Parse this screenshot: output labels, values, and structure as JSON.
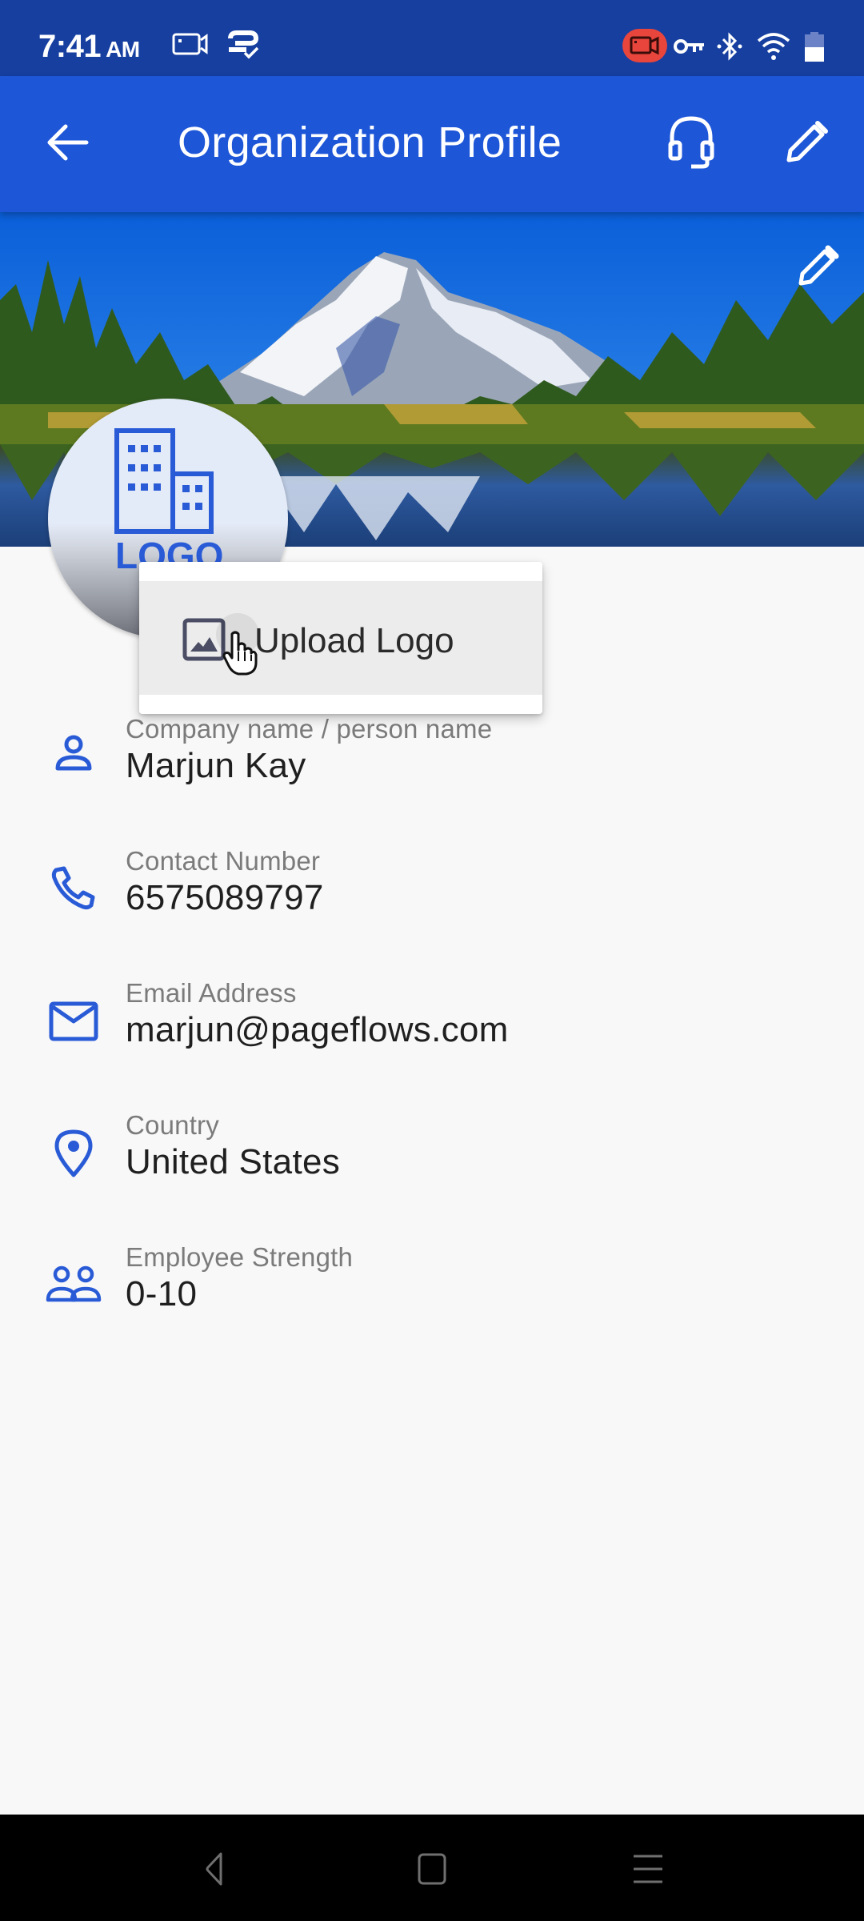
{
  "status_bar": {
    "time": "7:41",
    "ampm": "AM",
    "icons": [
      "screen-record-icon",
      "sync-check-icon",
      "recording-active-icon",
      "vpn-key-icon",
      "bluetooth-icon",
      "wifi-icon",
      "battery-icon"
    ],
    "recording_badge_color": "#e8453c"
  },
  "app_bar": {
    "title": "Organization Profile",
    "back_icon": "arrow-left-icon",
    "support_icon": "headset-icon",
    "edit_icon": "pencil-icon",
    "color": "#1e56d8"
  },
  "banner": {
    "description": "Mountain lake landscape cover image",
    "edit_icon": "pencil-icon"
  },
  "logo": {
    "placeholder_text": "LOGO",
    "icon": "building-icon"
  },
  "popup_menu": {
    "items": [
      {
        "label": "Upload Logo",
        "icon": "image-icon"
      }
    ]
  },
  "fields": [
    {
      "label": "Company name / person name",
      "value": "Marjun Kay",
      "icon": "person-icon"
    },
    {
      "label": "Contact Number",
      "value": "6575089797",
      "icon": "phone-icon"
    },
    {
      "label": "Email Address",
      "value": "marjun@pageflows.com",
      "icon": "mail-icon"
    },
    {
      "label": "Country",
      "value": "United States",
      "icon": "location-pin-icon"
    },
    {
      "label": "Employee Strength",
      "value": "0-10",
      "icon": "people-icon"
    }
  ],
  "accent_color": "#2a5bd7",
  "nav_bar": {
    "buttons": [
      "back-nav-icon",
      "home-nav-icon",
      "recents-nav-icon"
    ]
  }
}
